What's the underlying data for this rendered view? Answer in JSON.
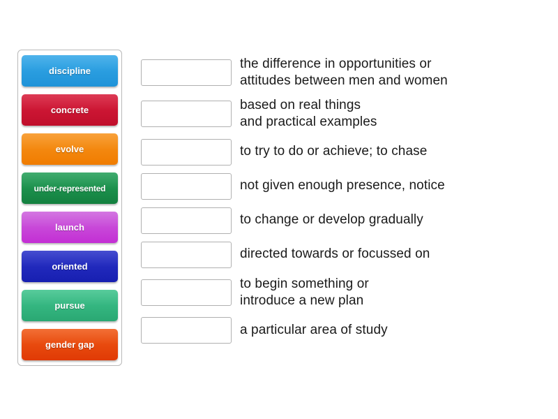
{
  "activity": {
    "type": "match-up",
    "tile_panel_name": "word-tiles"
  },
  "tiles": [
    {
      "label": "discipline",
      "color_start": "#35a8e8",
      "color_end": "#1f93d8"
    },
    {
      "label": "concrete",
      "color_start": "#d81e3c",
      "color_end": "#c00e2b"
    },
    {
      "label": "evolve",
      "color_start": "#f7941e",
      "color_end": "#f07c00"
    },
    {
      "label": "under-represented",
      "color_start": "#25a05a",
      "color_end": "#13803f"
    },
    {
      "label": "launch",
      "color_start": "#cd63dd",
      "color_end": "#c32ed4"
    },
    {
      "label": "oriented",
      "color_start": "#2b33c9",
      "color_end": "#171fb0"
    },
    {
      "label": "pursue",
      "color_start": "#3fc48d",
      "color_end": "#2aa873"
    },
    {
      "label": "gender gap",
      "color_start": "#f05a17",
      "color_end": "#e03a05"
    }
  ],
  "rows": [
    {
      "answer_value": "",
      "definition": "the difference in opportunities or\nattitudes between men and women"
    },
    {
      "answer_value": "",
      "definition": "based on real things\nand practical examples"
    },
    {
      "answer_value": "",
      "definition": "to try to do or achieve; to chase"
    },
    {
      "answer_value": "",
      "definition": "not given enough presence, notice"
    },
    {
      "answer_value": "",
      "definition": "to change or develop gradually"
    },
    {
      "answer_value": "",
      "definition": "directed towards or focussed on"
    },
    {
      "answer_value": "",
      "definition": "to begin something or\nintroduce a new plan"
    },
    {
      "answer_value": "",
      "definition": "a particular area of study"
    }
  ]
}
